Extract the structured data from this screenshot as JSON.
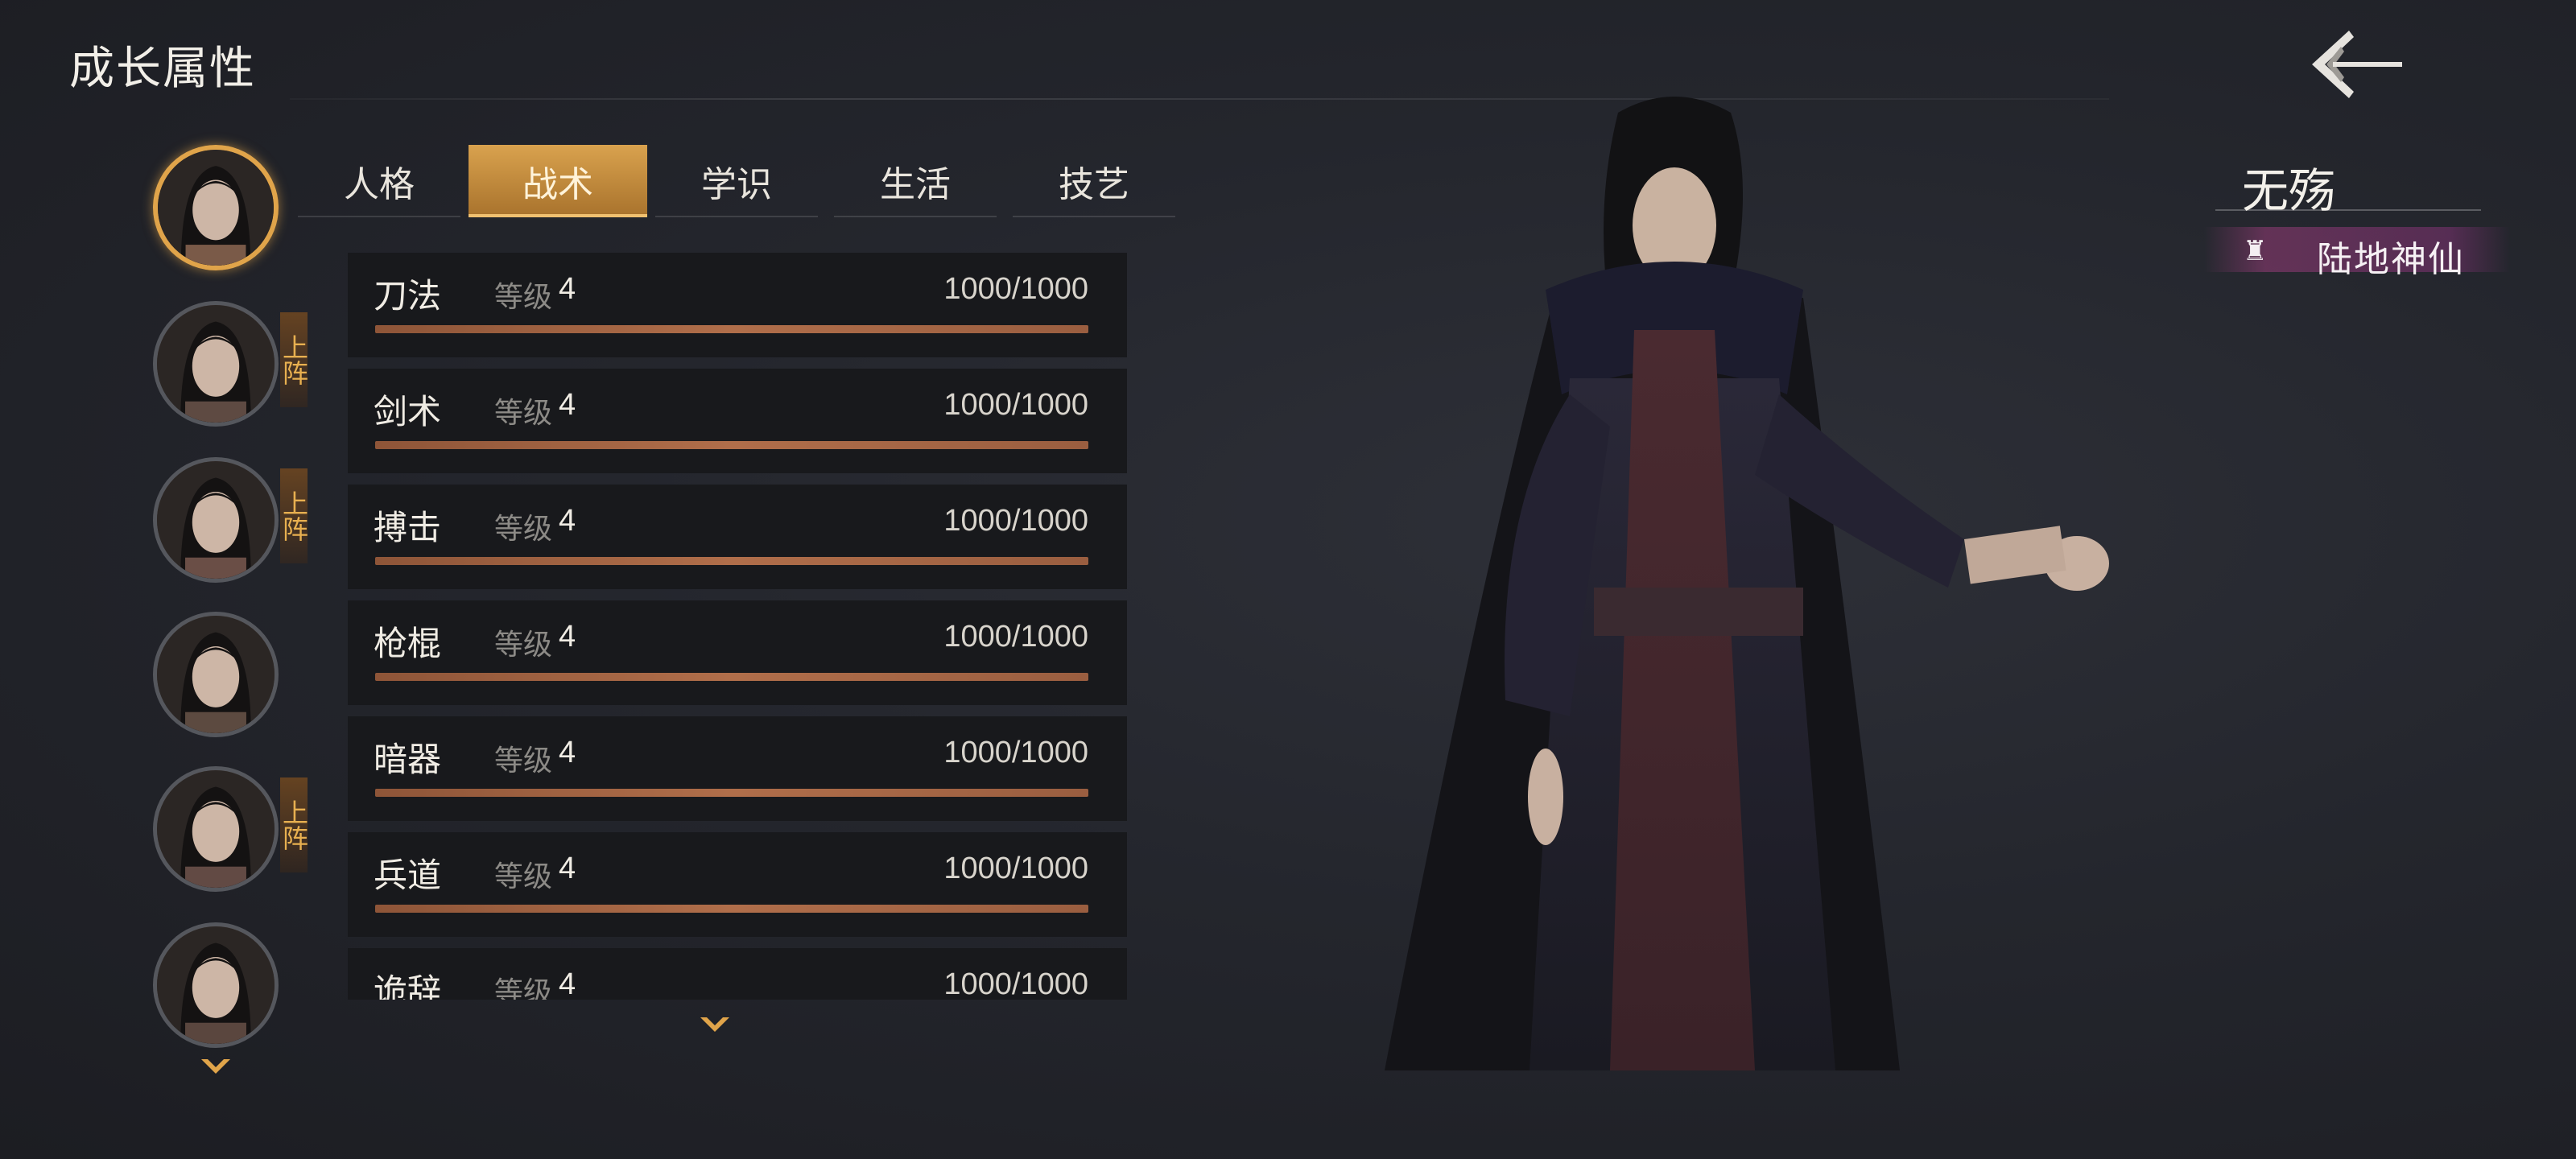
{
  "header": {
    "title": "成长属性"
  },
  "tabs": [
    {
      "label": "人格",
      "active": false
    },
    {
      "label": "战术",
      "active": true
    },
    {
      "label": "学识",
      "active": false
    },
    {
      "label": "生活",
      "active": false
    },
    {
      "label": "技艺",
      "active": false
    }
  ],
  "roster": {
    "deploy_label": "上阵",
    "members": [
      {
        "selected": true,
        "deployed": false
      },
      {
        "selected": false,
        "deployed": true
      },
      {
        "selected": false,
        "deployed": true
      },
      {
        "selected": false,
        "deployed": false
      },
      {
        "selected": false,
        "deployed": true
      },
      {
        "selected": false,
        "deployed": false
      }
    ]
  },
  "skills": [
    {
      "name": "刀法",
      "level_label": "等级",
      "level": "4",
      "exp": "1000/1000",
      "progress": 1.0
    },
    {
      "name": "剑术",
      "level_label": "等级",
      "level": "4",
      "exp": "1000/1000",
      "progress": 1.0
    },
    {
      "name": "搏击",
      "level_label": "等级",
      "level": "4",
      "exp": "1000/1000",
      "progress": 1.0
    },
    {
      "name": "枪棍",
      "level_label": "等级",
      "level": "4",
      "exp": "1000/1000",
      "progress": 1.0
    },
    {
      "name": "暗器",
      "level_label": "等级",
      "level": "4",
      "exp": "1000/1000",
      "progress": 1.0
    },
    {
      "name": "兵道",
      "level_label": "等级",
      "level": "4",
      "exp": "1000/1000",
      "progress": 1.0
    },
    {
      "name": "诡辞",
      "level_label": "等级",
      "level": "4",
      "exp": "1000/1000",
      "progress": 1.0
    }
  ],
  "character": {
    "name": "无殇",
    "rank": "陆地神仙",
    "rank_icon": "rank-emblem-icon"
  },
  "colors": {
    "accent": "#d9a24e",
    "bar_fill": "#b06e4a",
    "rank_bg": "#8c3c78"
  }
}
